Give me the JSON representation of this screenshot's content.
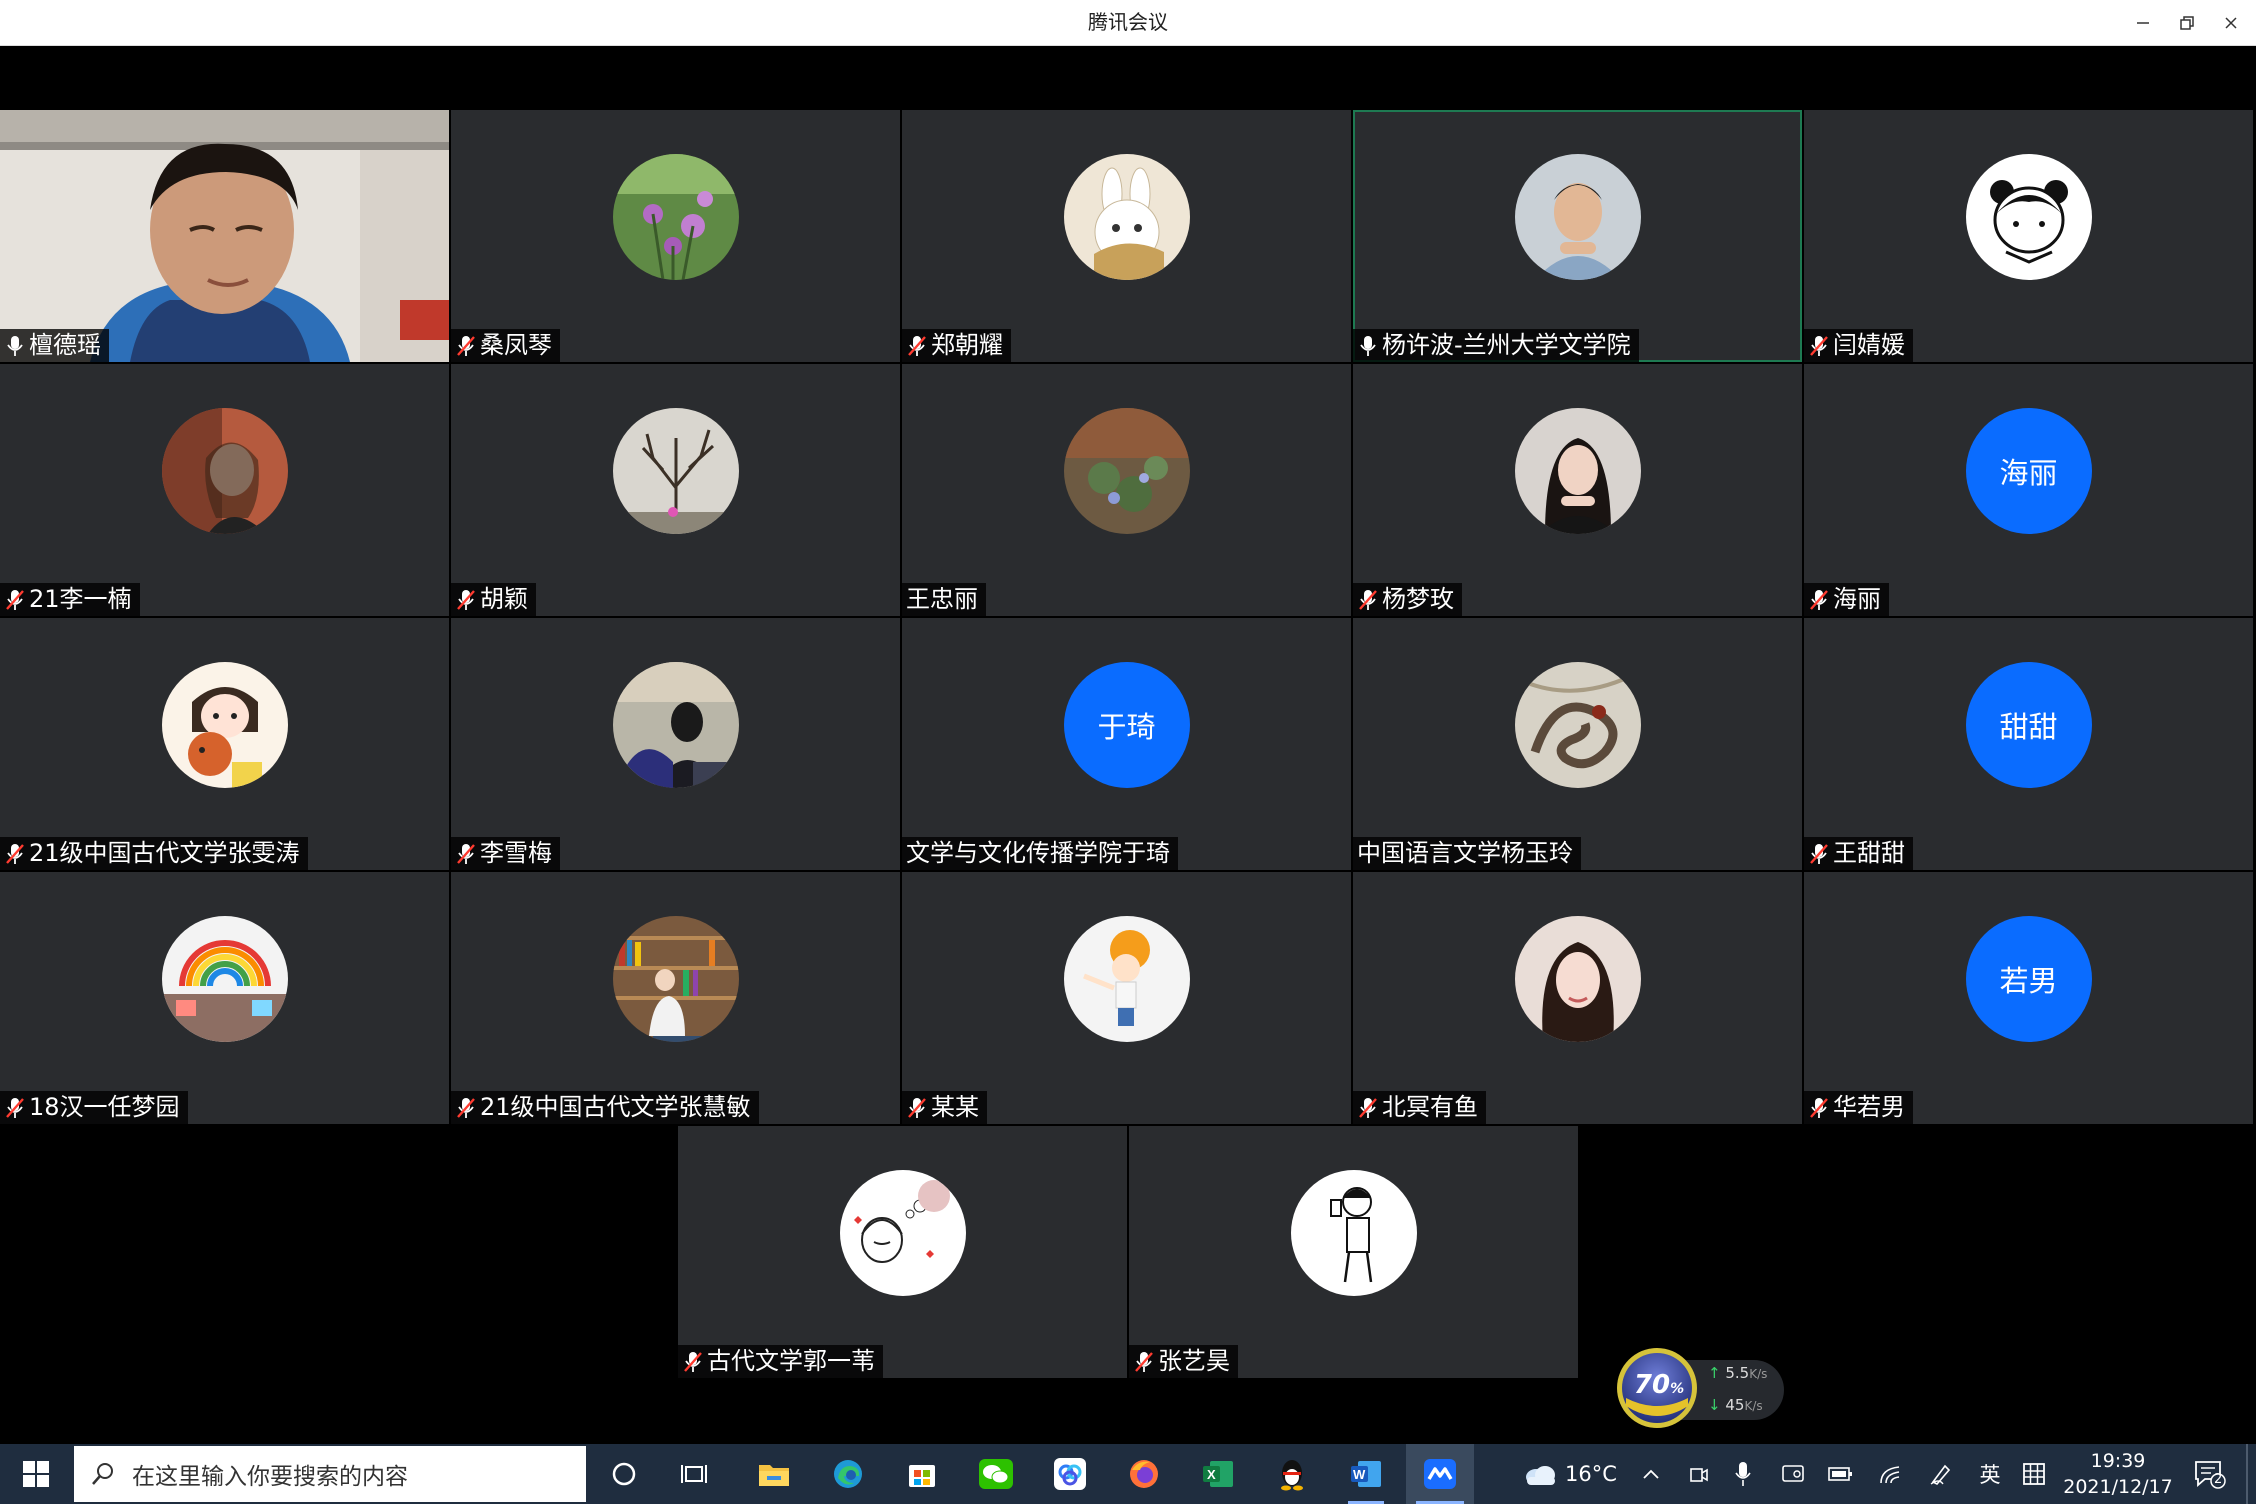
{
  "window": {
    "title": "腾讯会议"
  },
  "participants": [
    {
      "name": "檀德瑶",
      "avatar": "camera",
      "mic": "on"
    },
    {
      "name": "桑凤琴",
      "avatar": "flowers",
      "mic": "muted"
    },
    {
      "name": "郑朝耀",
      "avatar": "rabbit",
      "mic": "muted"
    },
    {
      "name": "杨许波-兰州大学文学院",
      "avatar": "man-photo",
      "mic": "on",
      "speaking": true
    },
    {
      "name": "闫婧媛",
      "avatar": "cartoon-girl",
      "mic": "muted"
    },
    {
      "name": "21李一楠",
      "avatar": "girl-photo",
      "mic": "muted"
    },
    {
      "name": "胡颖",
      "avatar": "tree",
      "mic": "muted"
    },
    {
      "name": "王忠丽",
      "avatar": "plants",
      "mic": "none"
    },
    {
      "name": "杨梦玫",
      "avatar": "woman-photo",
      "mic": "muted"
    },
    {
      "name": "海丽",
      "avatar": "text",
      "avatar_text": "海丽",
      "mic": "muted"
    },
    {
      "name": "21级中国古代文学张雯涛",
      "avatar": "girl-dog",
      "mic": "muted"
    },
    {
      "name": "李雪梅",
      "avatar": "masked-person",
      "mic": "muted"
    },
    {
      "name": "文学与文化传播学院于琦",
      "avatar": "text",
      "avatar_text": "于琦",
      "mic": "none"
    },
    {
      "name": "中国语言文学杨玉玲",
      "avatar": "dragon",
      "mic": "none"
    },
    {
      "name": "王甜甜",
      "avatar": "text",
      "avatar_text": "甜甜",
      "mic": "muted"
    },
    {
      "name": "18汉一任梦园",
      "avatar": "rainbow-board",
      "mic": "muted"
    },
    {
      "name": "21级中国古代文学张慧敏",
      "avatar": "library",
      "mic": "muted"
    },
    {
      "name": "某某",
      "avatar": "boy-orange",
      "mic": "muted"
    },
    {
      "name": "北冥有鱼",
      "avatar": "woman-portrait",
      "mic": "muted"
    },
    {
      "name": "华若男",
      "avatar": "text",
      "avatar_text": "若男",
      "mic": "muted"
    },
    {
      "name": "古代文学郭一苇",
      "avatar": "doodle-girl",
      "mic": "muted"
    },
    {
      "name": "张艺昊",
      "avatar": "doodle-boy",
      "mic": "muted"
    }
  ],
  "network_widget": {
    "percent": "70",
    "percent_unit": "%",
    "upload": "5.5",
    "download": "45",
    "unit": "K/s"
  },
  "taskbar": {
    "search_placeholder": "在这里输入你要搜索的内容",
    "weather": "16°C",
    "ime": "英",
    "time": "19:39",
    "date": "2021/12/17",
    "notification_count": "2",
    "apps": [
      "task-view",
      "file-explorer",
      "edge",
      "store",
      "wechat",
      "baidu-netdisk",
      "firefox",
      "excel",
      "qq",
      "word",
      "tencent-meeting"
    ]
  },
  "colors": {
    "tile_bg": "#2a2c2f",
    "avatar_blue": "#0a6cff",
    "taskbar_bg": "#1f2d3f",
    "speaking_border": "#1e7a52"
  }
}
